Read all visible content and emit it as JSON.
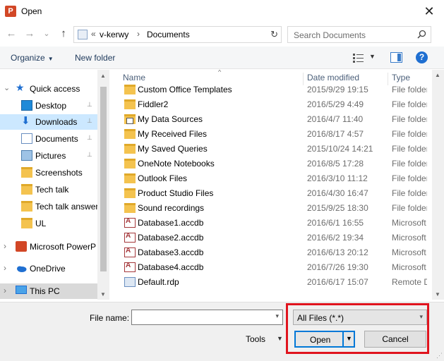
{
  "window": {
    "title": "Open",
    "app_icon_letter": "P",
    "close_glyph": "✕"
  },
  "address": {
    "overflow": "«",
    "path": [
      "v-kerwy",
      "Documents"
    ],
    "separator": "›",
    "refresh_glyph": "↻"
  },
  "search": {
    "placeholder": "Search Documents"
  },
  "nav_buttons": {
    "back": "←",
    "forward": "→",
    "recent": "⌄",
    "up": "↑"
  },
  "toolbar": {
    "organize": "Organize",
    "new_folder": "New folder",
    "caret": "▼"
  },
  "sidebar": {
    "items": [
      {
        "label": "Quick access",
        "icon": "star-icon",
        "expander": "⌄",
        "pinned": false
      },
      {
        "label": "Desktop",
        "icon": "desktop-icon",
        "pinned": true
      },
      {
        "label": "Downloads",
        "icon": "download-icon",
        "pinned": true,
        "selected": true
      },
      {
        "label": "Documents",
        "icon": "documents-icon",
        "pinned": true
      },
      {
        "label": "Pictures",
        "icon": "pictures-icon",
        "pinned": true
      },
      {
        "label": "Screenshots",
        "icon": "folder-icon"
      },
      {
        "label": "Tech talk",
        "icon": "folder-icon"
      },
      {
        "label": "Tech talk answer",
        "icon": "folder-icon"
      },
      {
        "label": "UL",
        "icon": "folder-icon"
      },
      {
        "label": "Microsoft PowerP",
        "icon": "powerpoint-icon",
        "expander": "›"
      },
      {
        "label": "OneDrive",
        "icon": "onedrive-icon",
        "expander": "›"
      },
      {
        "label": "This PC",
        "icon": "pc-icon",
        "expander": "›"
      }
    ],
    "pin_glyph": "📌"
  },
  "columns": {
    "name": "Name",
    "date": "Date modified",
    "type": "Type",
    "sort_glyph": "^"
  },
  "files": [
    {
      "name": "Custom Office Templates",
      "date": "2015/9/29 19:15",
      "type": "File folder",
      "kind": "folder"
    },
    {
      "name": "Fiddler2",
      "date": "2016/5/29 4:49",
      "type": "File folder",
      "kind": "folder"
    },
    {
      "name": "My Data Sources",
      "date": "2016/4/7 11:40",
      "type": "File folder",
      "kind": "datasrc"
    },
    {
      "name": "My Received Files",
      "date": "2016/8/17 4:57",
      "type": "File folder",
      "kind": "folder"
    },
    {
      "name": "My Saved Queries",
      "date": "2015/10/24 14:21",
      "type": "File folder",
      "kind": "folder"
    },
    {
      "name": "OneNote Notebooks",
      "date": "2016/8/5 17:28",
      "type": "File folder",
      "kind": "folder"
    },
    {
      "name": "Outlook Files",
      "date": "2016/3/10 11:12",
      "type": "File folder",
      "kind": "folder"
    },
    {
      "name": "Product Studio Files",
      "date": "2016/4/30 16:47",
      "type": "File folder",
      "kind": "folder"
    },
    {
      "name": "Sound recordings",
      "date": "2015/9/25 18:30",
      "type": "File folder",
      "kind": "folder"
    },
    {
      "name": "Database1.accdb",
      "date": "2016/6/1 16:55",
      "type": "Microsoft",
      "kind": "access"
    },
    {
      "name": "Database2.accdb",
      "date": "2016/6/2 19:34",
      "type": "Microsoft",
      "kind": "access"
    },
    {
      "name": "Database3.accdb",
      "date": "2016/6/13 20:12",
      "type": "Microsoft",
      "kind": "access"
    },
    {
      "name": "Database4.accdb",
      "date": "2016/7/26 19:30",
      "type": "Microsoft",
      "kind": "access"
    },
    {
      "name": "Default.rdp",
      "date": "2016/6/17 15:07",
      "type": "Remote D",
      "kind": "rdp"
    }
  ],
  "bottom": {
    "file_name_label": "File name:",
    "file_name_value": "",
    "filter": "All Files (*.*)",
    "tools": "Tools",
    "open": "Open",
    "cancel": "Cancel",
    "caret": "▾"
  },
  "colors": {
    "accent": "#0078d7",
    "highlight": "#e0141e",
    "selected": "#cce8ff"
  }
}
